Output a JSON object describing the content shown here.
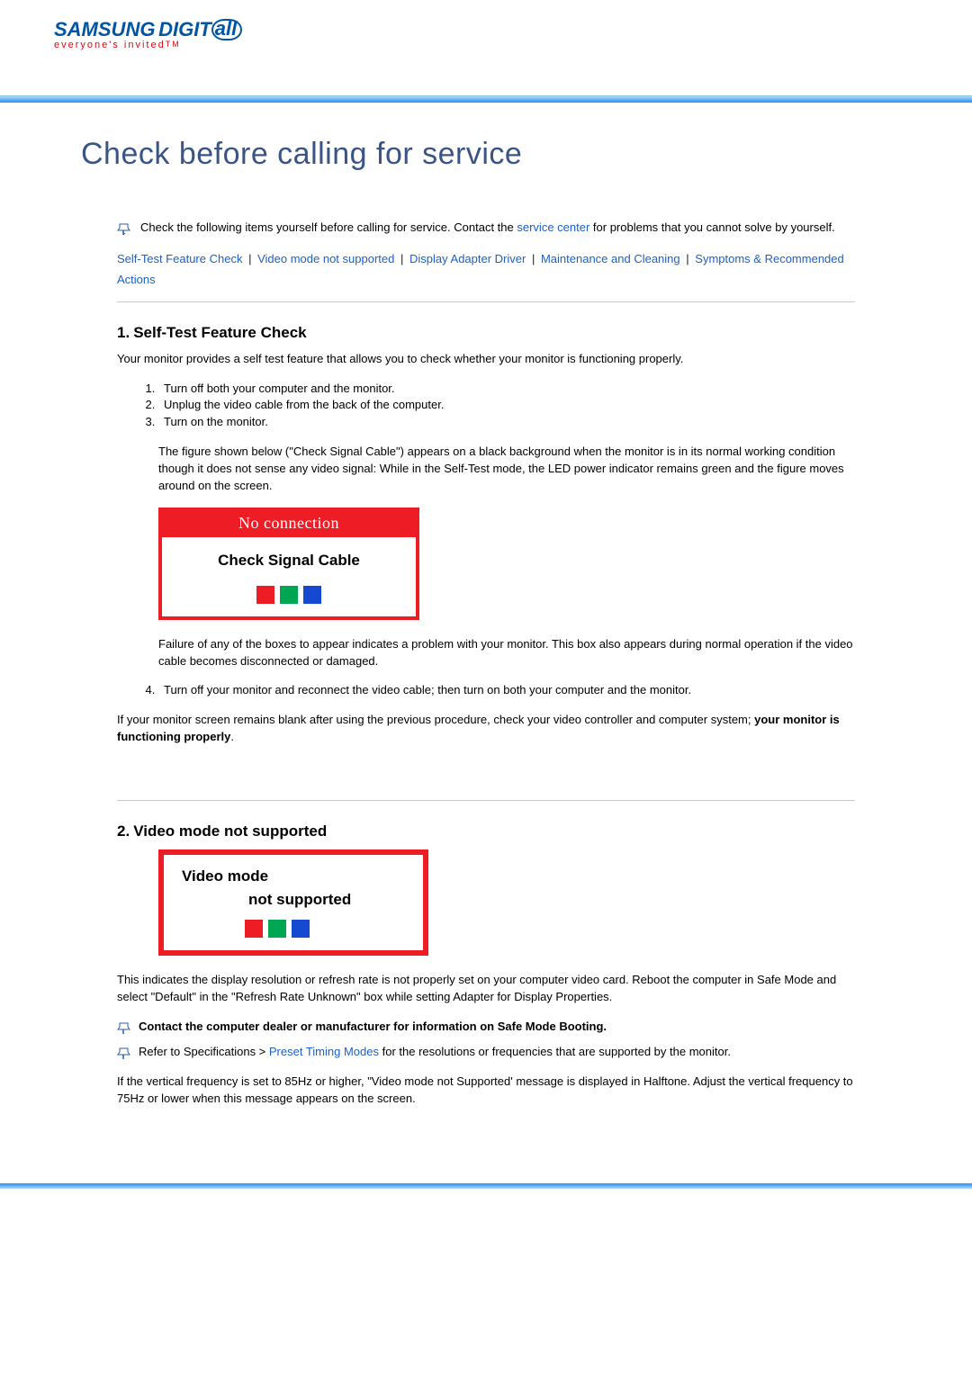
{
  "logo": {
    "brand": "SAMSUNG",
    "sub1": "DIGIT",
    "sub2": "all",
    "tagline": "everyone's invited",
    "tm": "TM"
  },
  "page_title": "Check before calling for service",
  "intro": {
    "text_before": "Check the following items yourself before calling for service. Contact the ",
    "link": "service center",
    "text_after": " for problems that you cannot solve by yourself."
  },
  "nav": {
    "items": [
      "Self-Test Feature Check",
      "Video mode not supported",
      "Display Adapter Driver",
      "Maintenance and Cleaning",
      "Symptoms & Recommended Actions"
    ],
    "sep": "|"
  },
  "section1": {
    "heading_num": "1.",
    "heading": "Self-Test Feature Check",
    "intro": "Your monitor provides a self test feature that allows you to check whether your monitor is functioning properly.",
    "steps": [
      "Turn off both your computer and the monitor.",
      "Unplug the video cable from the back of the computer.",
      "Turn on the monitor."
    ],
    "after_step3": "The figure shown below (\"Check Signal Cable\") appears on a black background when the monitor is in its normal working condition though it does not sense any video signal: While in the Self-Test mode, the LED power indicator remains green and the figure moves around on the screen.",
    "osd": {
      "header": "No connection",
      "text": "Check Signal Cable"
    },
    "failure_note": "Failure of any of the boxes to appear indicates a problem with your monitor. This box also appears during normal operation if the video cable becomes disconnected or damaged.",
    "step4": "Turn off your monitor and reconnect the video cable; then turn on both your computer and the monitor.",
    "closing_before": "If your monitor screen remains blank after using the previous procedure, check your video controller and computer system; ",
    "closing_bold": "your monitor is functioning properly",
    "closing_after": "."
  },
  "section2": {
    "heading_num": "2.",
    "heading": "Video mode not supported",
    "osd": {
      "line1": "Video mode",
      "line2": "not supported"
    },
    "paragraph": "This indicates the display resolution or refresh rate is not properly set on your computer video card. Reboot the computer in Safe Mode and select \"Default\" in the \"Refresh Rate Unknown\" box while setting Adapter for Display Properties.",
    "bold_note": "Contact the computer dealer or manufacturer for information on Safe Mode Booting.",
    "refer_before": "Refer to Specifications > ",
    "refer_link": "Preset Timing Modes",
    "refer_after": " for the resolutions or frequencies that are supported by the monitor.",
    "closing": "If the vertical frequency is set to 85Hz or higher, \"Video mode not Supported' message is displayed in Halftone. Adjust the vertical frequency to 75Hz or lower when this message appears on the screen."
  }
}
